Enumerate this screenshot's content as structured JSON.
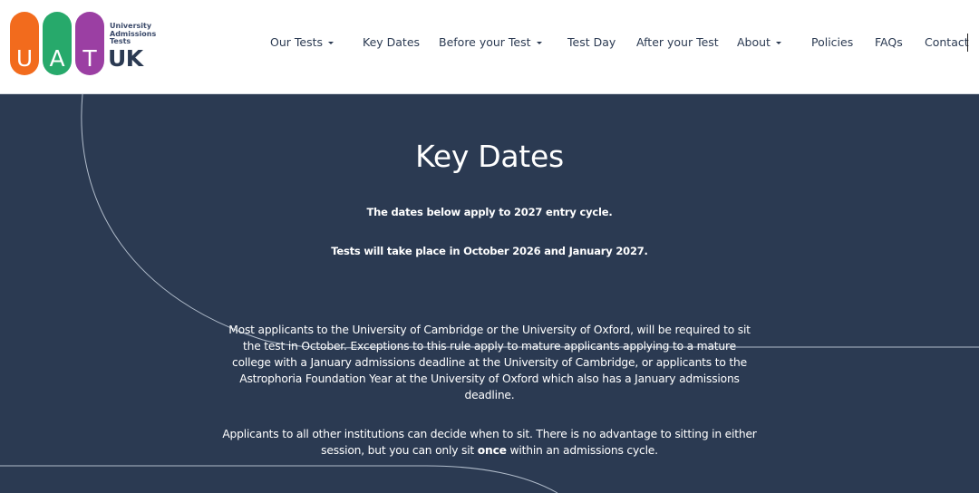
{
  "logo": {
    "letters": [
      "U",
      "A",
      "T"
    ],
    "small_lines": [
      "University",
      "Admissions",
      "Tests"
    ],
    "country": "UK",
    "colors": {
      "u": "#f26b1d",
      "a": "#27a96b",
      "t": "#9b3fa3"
    }
  },
  "nav": {
    "items": [
      {
        "label": "Our Tests",
        "dropdown": true
      },
      {
        "label": "Key Dates",
        "dropdown": false
      },
      {
        "label": "Before your Test",
        "dropdown": true
      },
      {
        "label": "Test Day",
        "dropdown": false
      },
      {
        "label": "After your Test",
        "dropdown": false
      },
      {
        "label": "About",
        "dropdown": true
      },
      {
        "label": "Policies",
        "dropdown": false
      },
      {
        "label": "FAQs",
        "dropdown": false
      },
      {
        "label": "Contact",
        "dropdown": false
      }
    ]
  },
  "page": {
    "title": "Key Dates",
    "intro_line_1": "The dates below apply to 2027 entry cycle.",
    "intro_line_2": "Tests will take place in October 2026 and January 2027.",
    "para1_lines": [
      "Most applicants to the University of Cambridge or the University of Oxford, will be required to sit",
      "the test in October. Exceptions to this rule apply to mature applicants applying to a mature",
      "college with a January admissions deadline at the University of Cambridge, or applicants to the",
      "Astrophoria Foundation Year at the University of Oxford which also has a January admissions",
      "deadline."
    ],
    "para2_line_1": "Applicants to all other institutions can decide when to sit. There is no advantage to sitting in either",
    "para2_line_2_pre": "session, but you can only sit ",
    "para2_line_2_bold": "once",
    "para2_line_2_post": " within an admissions cycle."
  },
  "colors": {
    "header_bg": "#ffffff",
    "body_bg": "#2b3a52",
    "nav_text": "#2b3a52",
    "curve": "#c9d3e0"
  }
}
